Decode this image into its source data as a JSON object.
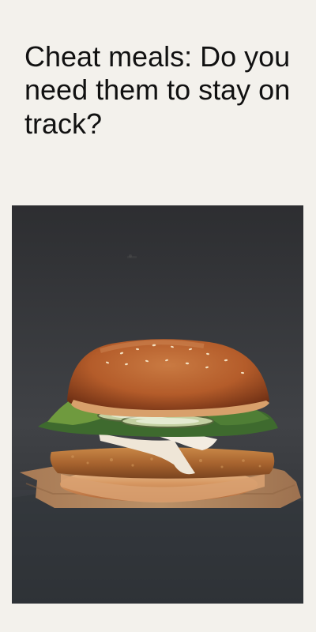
{
  "article": {
    "title": "Cheat meals: Do you need them to stay on track?"
  },
  "hero_image": {
    "subject": "burger-photo",
    "background_color": "#2f3032",
    "table_color": "#3a3d42",
    "bun_color": "#b45c2a",
    "patty_color": "#a8642f",
    "sauce_color": "#efe6d7",
    "lettuce_color": "#3e6a2e",
    "paper_color": "#b8875e"
  }
}
